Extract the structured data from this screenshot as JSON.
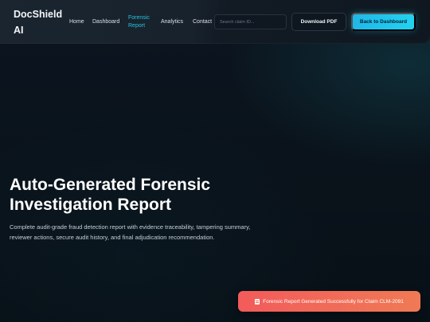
{
  "brand": {
    "name": "DocShield AI"
  },
  "nav": {
    "items": [
      {
        "label": "Home"
      },
      {
        "label": "Dashboard"
      },
      {
        "label": "Forensic Report",
        "active": true
      },
      {
        "label": "Analytics"
      },
      {
        "label": "Contact"
      }
    ]
  },
  "search": {
    "placeholder": "Search claim ID...",
    "value": ""
  },
  "actions": {
    "download_label": "Download PDF",
    "back_label": "Back to Dashboard"
  },
  "hero": {
    "title": "Auto-Generated Forensic Investigation Report",
    "description": "Complete audit-grade fraud detection report with evidence traceability, tampering summary, reviewer actions, secure audit history, and final adjudication recommendation."
  },
  "toast": {
    "icon": "document-icon",
    "message": "Forensic Report Generated Successfully for Claim CLM-2091"
  },
  "colors": {
    "accent": "#22c6e0",
    "primary_button": "#1fb8e8",
    "toast": "#f25b5b",
    "background": "#0a1118"
  }
}
